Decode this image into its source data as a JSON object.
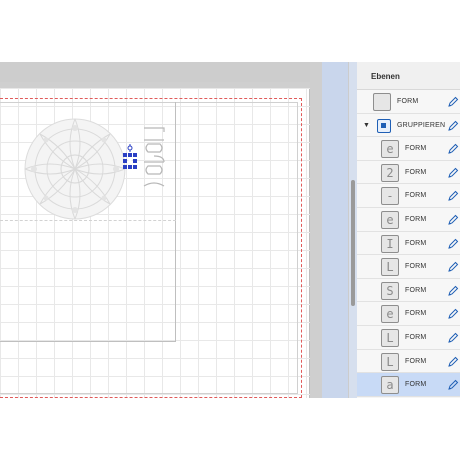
{
  "panel": {
    "title": "Ebenen"
  },
  "layers": [
    {
      "name": "FORM",
      "type": "shape",
      "indent": 0,
      "glyph": "",
      "selected": false
    },
    {
      "name": "GRUPPIEREN",
      "type": "group",
      "indent": 0,
      "glyph": "",
      "selected": false,
      "expanded": true
    },
    {
      "name": "FORM",
      "type": "shape",
      "indent": 1,
      "glyph": "e",
      "selected": false
    },
    {
      "name": "FORM",
      "type": "shape",
      "indent": 1,
      "glyph": "2",
      "selected": false
    },
    {
      "name": "FORM",
      "type": "shape",
      "indent": 1,
      "glyph": "-",
      "selected": false
    },
    {
      "name": "FORM",
      "type": "shape",
      "indent": 1,
      "glyph": "e",
      "selected": false
    },
    {
      "name": "FORM",
      "type": "shape",
      "indent": 1,
      "glyph": "I",
      "selected": false
    },
    {
      "name": "FORM",
      "type": "shape",
      "indent": 1,
      "glyph": "L",
      "selected": false
    },
    {
      "name": "FORM",
      "type": "shape",
      "indent": 1,
      "glyph": "S",
      "selected": false
    },
    {
      "name": "FORM",
      "type": "shape",
      "indent": 1,
      "glyph": "e",
      "selected": false
    },
    {
      "name": "FORM",
      "type": "shape",
      "indent": 1,
      "glyph": "L",
      "selected": false
    },
    {
      "name": "FORM",
      "type": "shape",
      "indent": 1,
      "glyph": "L",
      "selected": false
    },
    {
      "name": "FORM",
      "type": "shape",
      "indent": 1,
      "glyph": "a",
      "selected": true
    }
  ],
  "colors": {
    "accent": "#1f5fb5",
    "selection": "#c8daf6",
    "mat_border": "#e05a5a"
  },
  "icons": {
    "edit": "pen-icon",
    "group": "group-icon",
    "disclosure": "triangle-down-icon"
  }
}
